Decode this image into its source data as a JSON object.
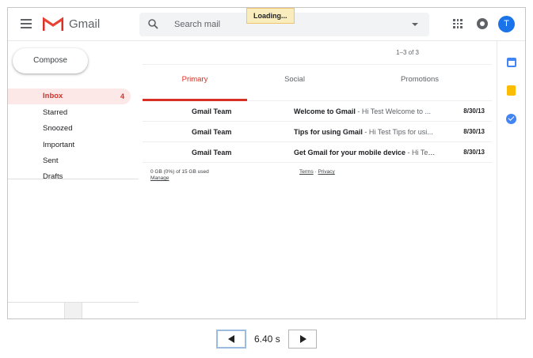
{
  "header": {
    "app_title": "Gmail",
    "search_placeholder": "Search mail",
    "loading_text": "Loading...",
    "avatar_letter": "T"
  },
  "sidebar": {
    "compose_label": "Compose",
    "items": [
      {
        "label": "Inbox",
        "count": "4",
        "active": true
      },
      {
        "label": "Starred",
        "count": ""
      },
      {
        "label": "Snoozed",
        "count": ""
      },
      {
        "label": "Important",
        "count": ""
      },
      {
        "label": "Sent",
        "count": ""
      },
      {
        "label": "Drafts",
        "count": ""
      }
    ]
  },
  "main": {
    "pager_text": "1–3 of 3",
    "tabs": [
      {
        "label": "Primary",
        "active": true
      },
      {
        "label": "Social"
      },
      {
        "label": "Promotions"
      }
    ],
    "emails": [
      {
        "from": "Gmail Team",
        "subject": "Welcome to Gmail",
        "snippet": " - Hi Test Welcome to ...",
        "date": "8/30/13"
      },
      {
        "from": "Gmail Team",
        "subject": "Tips for using Gmail",
        "snippet": " - Hi Test Tips for usi...",
        "date": "8/30/13"
      },
      {
        "from": "Gmail Team",
        "subject": "Get Gmail for your mobile device",
        "snippet": " - Hi Tes...",
        "date": "8/30/13"
      }
    ],
    "footer": {
      "storage": "0 GB (0%) of 15 GB used",
      "manage": "Manage",
      "terms": "Terms",
      "separator": " · ",
      "privacy": "Privacy"
    }
  },
  "side_panel": {
    "icons": [
      "calendar-icon",
      "keep-icon",
      "tasks-icon"
    ]
  },
  "player": {
    "time": "6.40 s"
  },
  "colors": {
    "accent_red": "#d93025",
    "active_bg": "#fce8e6",
    "avatar_blue": "#1a73e8",
    "loading_bg": "#f9edbe"
  }
}
